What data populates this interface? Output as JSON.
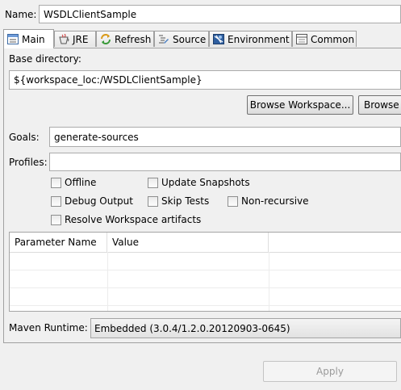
{
  "name": {
    "label": "Name:",
    "value": "WSDLClientSample"
  },
  "tabs": [
    {
      "label": "Main",
      "icon": "main-tab-icon"
    },
    {
      "label": "JRE",
      "icon": "jre-icon"
    },
    {
      "label": "Refresh",
      "icon": "refresh-icon"
    },
    {
      "label": "Source",
      "icon": "source-icon"
    },
    {
      "label": "Environment",
      "icon": "environment-icon"
    },
    {
      "label": "Common",
      "icon": "common-icon"
    }
  ],
  "main": {
    "base_dir_label": "Base directory:",
    "base_dir_value": "${workspace_loc:/WSDLClientSample}",
    "browse_workspace": "Browse Workspace...",
    "browse": "Browse",
    "goals_label": "Goals:",
    "goals_value": "generate-sources",
    "profiles_label": "Profiles:",
    "profiles_value": "",
    "checkboxes": {
      "offline": "Offline",
      "update_snapshots": "Update Snapshots",
      "debug_output": "Debug Output",
      "skip_tests": "Skip Tests",
      "non_recursive": "Non-recursive",
      "resolve_workspace": "Resolve Workspace artifacts"
    },
    "table": {
      "headers": [
        "Parameter Name",
        "Value"
      ],
      "rows": []
    },
    "maven_runtime_label": "Maven Runtime:",
    "maven_runtime_value": "Embedded (3.0.4/1.2.0.20120903-0645)"
  },
  "footer": {
    "apply": "Apply"
  }
}
